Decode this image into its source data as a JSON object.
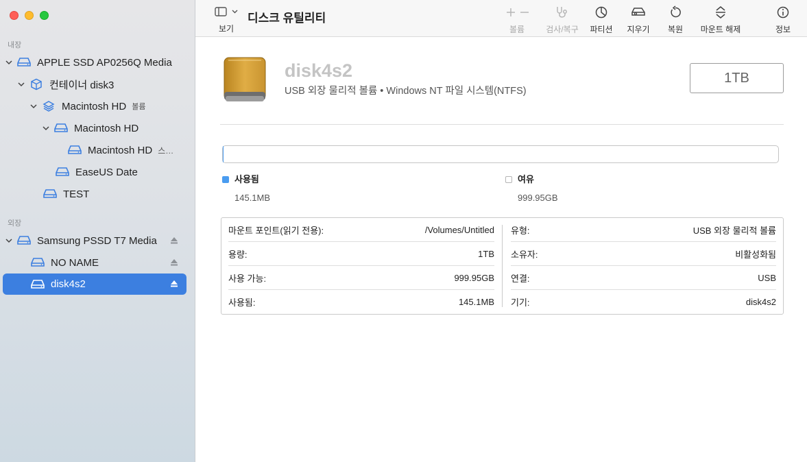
{
  "window": {
    "title": "디스크 유틸리티"
  },
  "toolbar": {
    "view_label": "보기",
    "buttons": [
      {
        "id": "volume",
        "label": "볼륨",
        "enabled": false
      },
      {
        "id": "firstaid",
        "label": "검사/복구",
        "enabled": false
      },
      {
        "id": "partition",
        "label": "파티션",
        "enabled": true
      },
      {
        "id": "erase",
        "label": "지우기",
        "enabled": true
      },
      {
        "id": "restore",
        "label": "복원",
        "enabled": true
      },
      {
        "id": "unmount",
        "label": "마운트 해제",
        "enabled": true
      },
      {
        "id": "info",
        "label": "정보",
        "enabled": true
      }
    ]
  },
  "sidebar": {
    "internal_label": "내장",
    "external_label": "외장",
    "items": [
      {
        "label": "APPLE SSD AP0256Q Media",
        "icon": "drive-icon"
      },
      {
        "label": "컨테이너 disk3",
        "icon": "container-icon"
      },
      {
        "label": "Macintosh HD",
        "sub": "볼륨",
        "icon": "layers-icon"
      },
      {
        "label": "Macintosh HD",
        "icon": "drive-icon"
      },
      {
        "label": "Macintosh HD",
        "sub": "스…",
        "icon": "drive-icon"
      },
      {
        "label": "EaseUS Date",
        "icon": "drive-icon"
      },
      {
        "label": "TEST",
        "icon": "drive-icon"
      },
      {
        "label": "Samsung PSSD T7 Media",
        "icon": "drive-icon"
      },
      {
        "label": "NO NAME",
        "icon": "drive-icon"
      },
      {
        "label": "disk4s2",
        "icon": "drive-icon",
        "selected": true
      }
    ]
  },
  "volume": {
    "name": "disk4s2",
    "description": "USB 외장 물리적 볼륨 • Windows NT 파일 시스템(NTFS)",
    "capacity": "1TB",
    "used_fraction": 0.000145
  },
  "usage": {
    "used_label": "사용됨",
    "used_value": "145.1MB",
    "free_label": "여유",
    "free_value": "999.95GB"
  },
  "info": {
    "left": [
      {
        "key": "마운트 포인트(읽기 전용):",
        "value": "/Volumes/Untitled"
      },
      {
        "key": "용량:",
        "value": "1TB"
      },
      {
        "key": "사용 가능:",
        "value": "999.95GB"
      },
      {
        "key": "사용됨:",
        "value": "145.1MB"
      }
    ],
    "right": [
      {
        "key": "유형:",
        "value": "USB 외장 물리적 볼륨"
      },
      {
        "key": "소유자:",
        "value": "비활성화됨"
      },
      {
        "key": "연결:",
        "value": "USB"
      },
      {
        "key": "기기:",
        "value": "disk4s2"
      }
    ]
  },
  "colors": {
    "accent": "#3c7fe0",
    "used": "#4a9cf0",
    "disk": "#d6a23c"
  }
}
